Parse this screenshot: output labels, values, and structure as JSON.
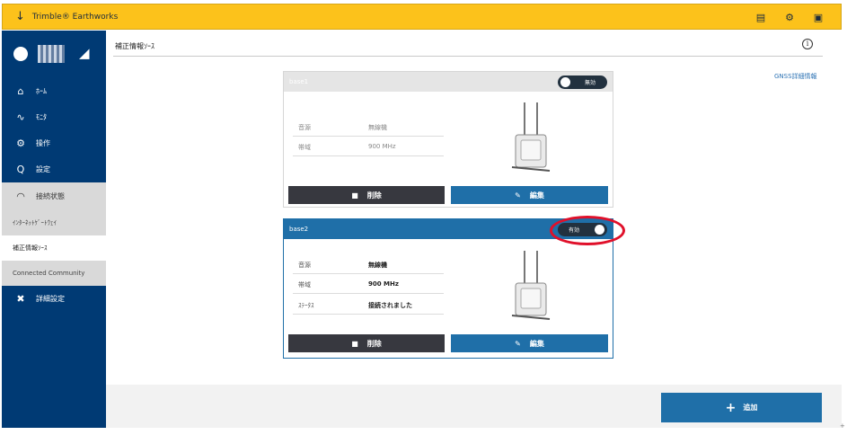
{
  "app": {
    "title": "Trimble® Earthworks"
  },
  "header_icons": [
    "report-icon",
    "machine-settings-icon",
    "help-icon"
  ],
  "sidebar": {
    "nav": [
      {
        "label": "ﾎｰﾑ",
        "icon": "home-icon"
      },
      {
        "label": "ﾓﾆﾀ",
        "icon": "monitor-icon"
      },
      {
        "label": "操作",
        "icon": "operation-icon"
      },
      {
        "label": "設定",
        "icon": "settings-icon"
      },
      {
        "label": "接続状態",
        "icon": "wifi-icon"
      }
    ],
    "sub": [
      {
        "label": "ｲﾝﾀｰﾈｯﾄｹﾞｰﾄｳｪｲ"
      },
      {
        "label": "補正情報ｿｰｽ"
      },
      {
        "label": "Connected Community"
      }
    ],
    "advanced": {
      "label": "詳細設定",
      "icon": "tools-icon"
    }
  },
  "main": {
    "title": "補正情報ｿｰｽ",
    "gnss_link": "GNSS詳細情報",
    "cards": [
      {
        "name": "base1",
        "toggle_label": "無効",
        "toggle_on": false,
        "props": [
          {
            "key": "音源",
            "value": "無線機"
          },
          {
            "key": "帯域",
            "value": "900 MHz"
          }
        ],
        "delete_label": "削除",
        "edit_label": "編集"
      },
      {
        "name": "base2",
        "toggle_label": "有効",
        "toggle_on": true,
        "props": [
          {
            "key": "音源",
            "value": "無線機"
          },
          {
            "key": "帯域",
            "value": "900 MHz"
          },
          {
            "key": "ｽﾃｰﾀｽ",
            "value": "接続されました"
          }
        ],
        "delete_label": "削除",
        "edit_label": "編集"
      }
    ],
    "add_label": "追加"
  },
  "colors": {
    "topbar": "#fcc21b",
    "sidebar": "#003a74",
    "accent": "#1f6fa8",
    "delete": "#37383f",
    "highlight": "#e0102a"
  }
}
